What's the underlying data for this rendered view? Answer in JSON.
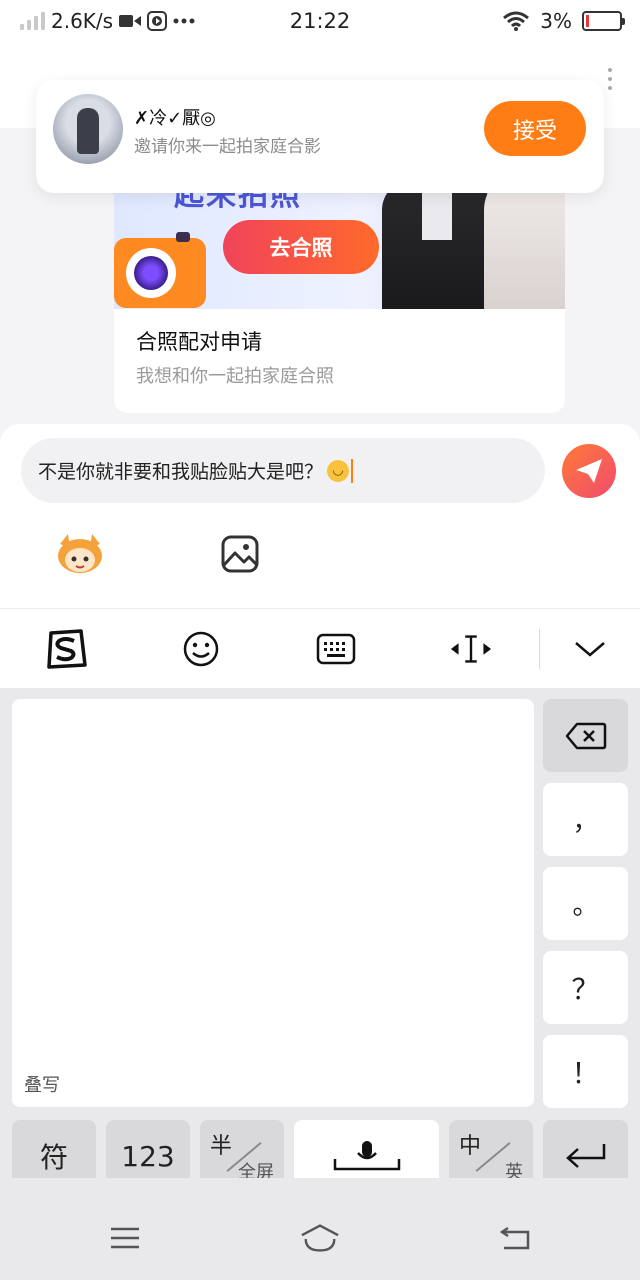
{
  "status_bar": {
    "net_speed": "2.6K/s",
    "time": "21:22",
    "battery": "3%",
    "battery_level": 0.03,
    "icons": [
      "signal-icon",
      "video-icon",
      "media-icon",
      "more-dots-icon",
      "wifi-icon",
      "battery-icon"
    ]
  },
  "invite": {
    "name": "✗冷✓厭◎",
    "message": "邀请你来一起拍家庭合影",
    "accept_label": "接受"
  },
  "chat_card": {
    "banner_heading": "起来拍照",
    "go_photo_label": "去合照",
    "title": "合照配对申请",
    "subtitle": "我想和你一起拍家庭合照"
  },
  "composer": {
    "text": "不是你就非要和我贴脸贴大是吧？",
    "emoji": "upside-down-face",
    "icons": [
      "send-icon",
      "mascot-sticker-icon",
      "image-icon"
    ]
  },
  "keyboard_toolbar": {
    "icons": [
      "sogou-logo-icon",
      "emoji-smile-icon",
      "keyboard-icon",
      "cursor-move-icon",
      "collapse-chevron-icon"
    ]
  },
  "keyboard": {
    "handwriting_label": "叠写",
    "side_keys": [
      "，",
      "。",
      "？",
      "！"
    ],
    "bottom": {
      "symbols": "符",
      "numbers": "123",
      "half_top": "半",
      "half_bottom": "全屏",
      "cn_top": "中",
      "cn_bottom": "英"
    }
  },
  "nav_bar": {
    "icons": [
      "menu-icon",
      "home-icon",
      "back-icon"
    ]
  },
  "colors": {
    "accent_orange": "#ff7d14",
    "send_gradient_start": "#ff7a38",
    "send_gradient_end": "#f04b6e",
    "go_photo_red": "#f0435a"
  }
}
